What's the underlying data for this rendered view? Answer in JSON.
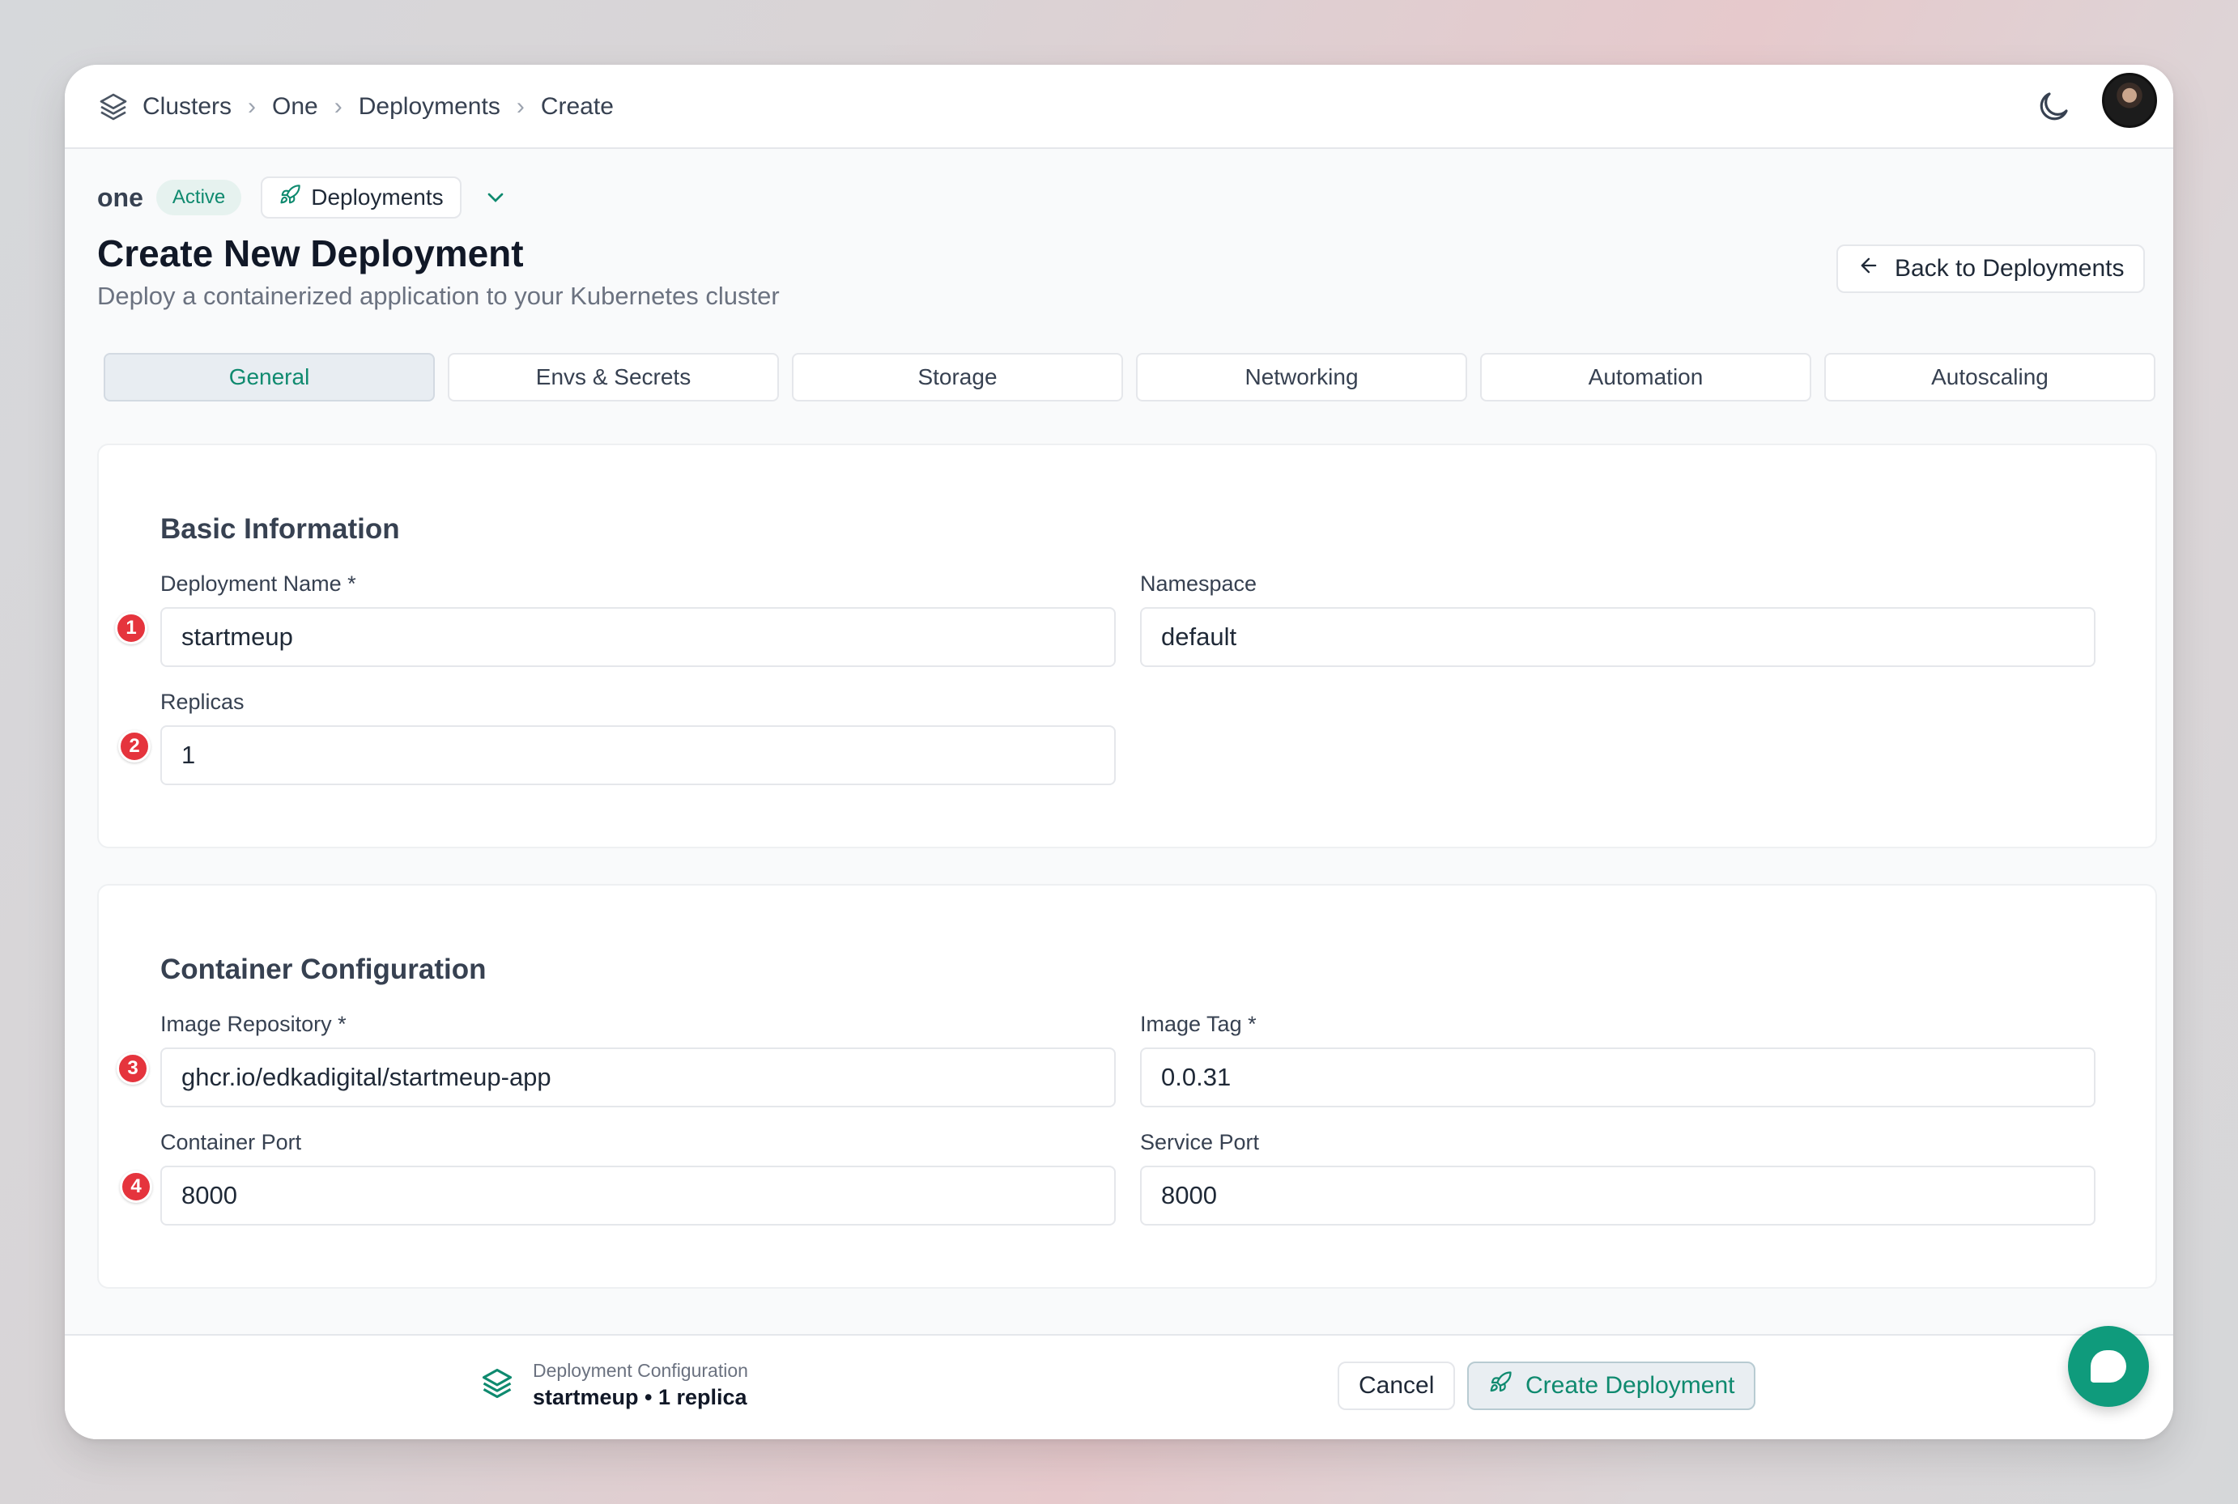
{
  "breadcrumb": {
    "items": [
      "Clusters",
      "One",
      "Deployments",
      "Create"
    ]
  },
  "context": {
    "cluster": "one",
    "status": "Active",
    "section": "Deployments"
  },
  "header": {
    "title": "Create New Deployment",
    "subtitle": "Deploy a containerized application to your Kubernetes cluster",
    "back_label": "Back to Deployments"
  },
  "tabs": [
    "General",
    "Envs & Secrets",
    "Storage",
    "Networking",
    "Automation",
    "Autoscaling"
  ],
  "basic": {
    "title": "Basic Information",
    "deployment_name_label": "Deployment Name *",
    "deployment_name_value": "startmeup",
    "namespace_label": "Namespace",
    "namespace_value": "default",
    "replicas_label": "Replicas",
    "replicas_value": "1"
  },
  "container": {
    "title": "Container Configuration",
    "image_repo_label": "Image Repository *",
    "image_repo_value": "ghcr.io/edkadigital/startmeup-app",
    "image_tag_label": "Image Tag *",
    "image_tag_value": "0.0.31",
    "container_port_label": "Container Port",
    "container_port_value": "8000",
    "service_port_label": "Service Port",
    "service_port_value": "8000"
  },
  "markers": [
    "1",
    "2",
    "3",
    "4"
  ],
  "footer": {
    "config_label": "Deployment Configuration",
    "config_value": "startmeup • 1 replica",
    "cancel_label": "Cancel",
    "create_label": "Create Deployment"
  },
  "colors": {
    "accent": "#0f8a6f",
    "marker": "#e5343d",
    "fab": "#0f9b7c"
  },
  "icons": [
    "layers-icon",
    "chevron-right-icon",
    "moon-icon",
    "rocket-icon",
    "chevron-down-icon",
    "arrow-left-icon",
    "chat-icon"
  ]
}
